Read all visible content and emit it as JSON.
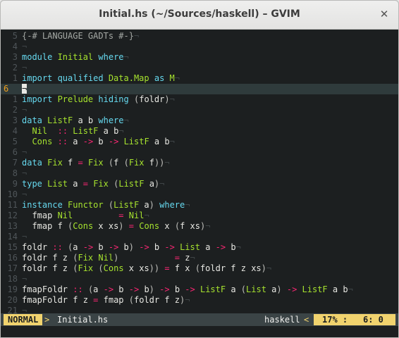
{
  "window": {
    "title": "Initial.hs (~/Sources/haskell) – GVIM",
    "close_glyph": "✕"
  },
  "eol_glyph": "¬",
  "lines": [
    {
      "num": "5",
      "tokens": [
        [
          "c-comment",
          "{-# LANGUAGE GADTs #-}"
        ]
      ]
    },
    {
      "num": "4",
      "tokens": []
    },
    {
      "num": "3",
      "tokens": [
        [
          "c-kw",
          "module "
        ],
        [
          "c-type",
          "Initial"
        ],
        [
          "c-plain",
          " "
        ],
        [
          "c-kw",
          "where"
        ]
      ]
    },
    {
      "num": "2",
      "tokens": []
    },
    {
      "num": "1",
      "tokens": [
        [
          "c-kw",
          "import qualified "
        ],
        [
          "c-type",
          "Data.Map"
        ],
        [
          "c-plain",
          " "
        ],
        [
          "c-kw",
          "as"
        ],
        [
          "c-plain",
          " "
        ],
        [
          "c-type",
          "M"
        ]
      ]
    },
    {
      "num": "6",
      "current": true,
      "tokens": []
    },
    {
      "num": "1",
      "tokens": [
        [
          "c-kw",
          "import "
        ],
        [
          "c-type",
          "Prelude"
        ],
        [
          "c-plain",
          " "
        ],
        [
          "c-kw",
          "hiding"
        ],
        [
          "c-plain",
          " "
        ],
        [
          "c-paren",
          "("
        ],
        [
          "c-plain",
          "foldr"
        ],
        [
          "c-paren",
          ")"
        ]
      ]
    },
    {
      "num": "2",
      "tokens": []
    },
    {
      "num": "3",
      "tokens": [
        [
          "c-kw",
          "data "
        ],
        [
          "c-type",
          "ListF"
        ],
        [
          "c-plain",
          " a b "
        ],
        [
          "c-kw",
          "where"
        ]
      ]
    },
    {
      "num": "4",
      "tokens": [
        [
          "c-plain",
          "  "
        ],
        [
          "c-type",
          "Nil"
        ],
        [
          "c-plain",
          "  "
        ],
        [
          "c-op",
          "::"
        ],
        [
          "c-plain",
          " "
        ],
        [
          "c-type",
          "ListF"
        ],
        [
          "c-plain",
          " a b"
        ]
      ]
    },
    {
      "num": "5",
      "tokens": [
        [
          "c-plain",
          "  "
        ],
        [
          "c-type",
          "Cons"
        ],
        [
          "c-plain",
          " "
        ],
        [
          "c-op",
          "::"
        ],
        [
          "c-plain",
          " a "
        ],
        [
          "c-op",
          "->"
        ],
        [
          "c-plain",
          " b "
        ],
        [
          "c-op",
          "->"
        ],
        [
          "c-plain",
          " "
        ],
        [
          "c-type",
          "ListF"
        ],
        [
          "c-plain",
          " a b"
        ]
      ]
    },
    {
      "num": "6",
      "tokens": []
    },
    {
      "num": "7",
      "tokens": [
        [
          "c-kw",
          "data "
        ],
        [
          "c-type",
          "Fix"
        ],
        [
          "c-plain",
          " f "
        ],
        [
          "c-op",
          "="
        ],
        [
          "c-plain",
          " "
        ],
        [
          "c-type",
          "Fix"
        ],
        [
          "c-plain",
          " "
        ],
        [
          "c-paren",
          "("
        ],
        [
          "c-plain",
          "f "
        ],
        [
          "c-paren",
          "("
        ],
        [
          "c-type",
          "Fix"
        ],
        [
          "c-plain",
          " f"
        ],
        [
          "c-paren",
          "))"
        ]
      ]
    },
    {
      "num": "8",
      "tokens": []
    },
    {
      "num": "9",
      "tokens": [
        [
          "c-kw",
          "type "
        ],
        [
          "c-type",
          "List"
        ],
        [
          "c-plain",
          " a "
        ],
        [
          "c-op",
          "="
        ],
        [
          "c-plain",
          " "
        ],
        [
          "c-type",
          "Fix"
        ],
        [
          "c-plain",
          " "
        ],
        [
          "c-paren",
          "("
        ],
        [
          "c-type",
          "ListF"
        ],
        [
          "c-plain",
          " a"
        ],
        [
          "c-paren",
          ")"
        ]
      ]
    },
    {
      "num": "10",
      "tokens": []
    },
    {
      "num": "11",
      "tokens": [
        [
          "c-kw",
          "instance "
        ],
        [
          "c-type",
          "Functor"
        ],
        [
          "c-plain",
          " "
        ],
        [
          "c-paren",
          "("
        ],
        [
          "c-type",
          "ListF"
        ],
        [
          "c-plain",
          " a"
        ],
        [
          "c-paren",
          ")"
        ],
        [
          "c-plain",
          " "
        ],
        [
          "c-kw",
          "where"
        ]
      ]
    },
    {
      "num": "12",
      "tokens": [
        [
          "c-plain",
          "  fmap "
        ],
        [
          "c-type",
          "Nil"
        ],
        [
          "c-plain",
          "         "
        ],
        [
          "c-op",
          "="
        ],
        [
          "c-plain",
          " "
        ],
        [
          "c-type",
          "Nil"
        ]
      ]
    },
    {
      "num": "13",
      "tokens": [
        [
          "c-plain",
          "  fmap f "
        ],
        [
          "c-paren",
          "("
        ],
        [
          "c-type",
          "Cons"
        ],
        [
          "c-plain",
          " x xs"
        ],
        [
          "c-paren",
          ")"
        ],
        [
          "c-plain",
          " "
        ],
        [
          "c-op",
          "="
        ],
        [
          "c-plain",
          " "
        ],
        [
          "c-type",
          "Cons"
        ],
        [
          "c-plain",
          " x "
        ],
        [
          "c-paren",
          "("
        ],
        [
          "c-plain",
          "f xs"
        ],
        [
          "c-paren",
          ")"
        ]
      ]
    },
    {
      "num": "14",
      "tokens": []
    },
    {
      "num": "15",
      "tokens": [
        [
          "c-plain",
          "foldr "
        ],
        [
          "c-op",
          "::"
        ],
        [
          "c-plain",
          " "
        ],
        [
          "c-paren",
          "("
        ],
        [
          "c-plain",
          "a "
        ],
        [
          "c-op",
          "->"
        ],
        [
          "c-plain",
          " b "
        ],
        [
          "c-op",
          "->"
        ],
        [
          "c-plain",
          " b"
        ],
        [
          "c-paren",
          ")"
        ],
        [
          "c-plain",
          " "
        ],
        [
          "c-op",
          "->"
        ],
        [
          "c-plain",
          " b "
        ],
        [
          "c-op",
          "->"
        ],
        [
          "c-plain",
          " "
        ],
        [
          "c-type",
          "List"
        ],
        [
          "c-plain",
          " a "
        ],
        [
          "c-op",
          "->"
        ],
        [
          "c-plain",
          " b"
        ]
      ]
    },
    {
      "num": "16",
      "tokens": [
        [
          "c-plain",
          "foldr f z "
        ],
        [
          "c-paren",
          "("
        ],
        [
          "c-type",
          "Fix Nil"
        ],
        [
          "c-paren",
          ")"
        ],
        [
          "c-plain",
          "           "
        ],
        [
          "c-op",
          "="
        ],
        [
          "c-plain",
          " z"
        ]
      ]
    },
    {
      "num": "17",
      "tokens": [
        [
          "c-plain",
          "foldr f z "
        ],
        [
          "c-paren",
          "("
        ],
        [
          "c-type",
          "Fix"
        ],
        [
          "c-plain",
          " "
        ],
        [
          "c-paren",
          "("
        ],
        [
          "c-type",
          "Cons"
        ],
        [
          "c-plain",
          " x xs"
        ],
        [
          "c-paren",
          "))"
        ],
        [
          "c-plain",
          " "
        ],
        [
          "c-op",
          "="
        ],
        [
          "c-plain",
          " f x "
        ],
        [
          "c-paren",
          "("
        ],
        [
          "c-plain",
          "foldr f z xs"
        ],
        [
          "c-paren",
          ")"
        ]
      ]
    },
    {
      "num": "18",
      "tokens": []
    },
    {
      "num": "19",
      "tokens": [
        [
          "c-plain",
          "fmapFoldr "
        ],
        [
          "c-op",
          "::"
        ],
        [
          "c-plain",
          " "
        ],
        [
          "c-paren",
          "("
        ],
        [
          "c-plain",
          "a "
        ],
        [
          "c-op",
          "->"
        ],
        [
          "c-plain",
          " b "
        ],
        [
          "c-op",
          "->"
        ],
        [
          "c-plain",
          " b"
        ],
        [
          "c-paren",
          ")"
        ],
        [
          "c-plain",
          " "
        ],
        [
          "c-op",
          "->"
        ],
        [
          "c-plain",
          " b "
        ],
        [
          "c-op",
          "->"
        ],
        [
          "c-plain",
          " "
        ],
        [
          "c-type",
          "ListF"
        ],
        [
          "c-plain",
          " a "
        ],
        [
          "c-paren",
          "("
        ],
        [
          "c-type",
          "List"
        ],
        [
          "c-plain",
          " a"
        ],
        [
          "c-paren",
          ")"
        ],
        [
          "c-plain",
          " "
        ],
        [
          "c-op",
          "->"
        ],
        [
          "c-plain",
          " "
        ],
        [
          "c-type",
          "ListF"
        ],
        [
          "c-plain",
          " a b"
        ]
      ]
    },
    {
      "num": "20",
      "tokens": [
        [
          "c-plain",
          "fmapFoldr f z "
        ],
        [
          "c-op",
          "="
        ],
        [
          "c-plain",
          " fmap "
        ],
        [
          "c-paren",
          "("
        ],
        [
          "c-plain",
          "foldr f z"
        ],
        [
          "c-paren",
          ")"
        ]
      ]
    },
    {
      "num": "21",
      "tokens": []
    }
  ],
  "statusline": {
    "mode": "NORMAL",
    "sep_right": ">",
    "filename": "Initial.hs",
    "filetype": "haskell",
    "sep_left": "<",
    "percent": "17% :",
    "colon": "",
    "line_col": "6:  0"
  },
  "colors": {
    "background": "#1c1f20",
    "keyword": "#66d9ef",
    "type": "#a6e22e",
    "operator": "#f92672",
    "comment": "#a4a8a4",
    "statusline_accent": "#f1d36e",
    "current_line_number": "#f0a020"
  },
  "icons": {
    "close": "close-icon"
  }
}
